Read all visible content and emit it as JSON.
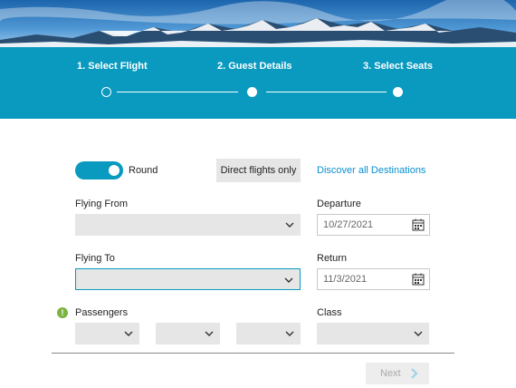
{
  "stepper": {
    "steps": [
      {
        "label": "1. Select Flight",
        "state": "current"
      },
      {
        "label": "2. Guest Details",
        "state": "upcoming"
      },
      {
        "label": "3. Select Seats",
        "state": "upcoming"
      }
    ]
  },
  "trip": {
    "toggle_label": "Round",
    "toggle_on": true,
    "direct_flights_label": "Direct flights only",
    "discover_link": "Discover all Destinations"
  },
  "form": {
    "flying_from_label": "Flying From",
    "flying_from_value": "",
    "flying_to_label": "Flying To",
    "flying_to_value": "",
    "departure_label": "Departure",
    "departure_value": "10/27/2021",
    "return_label": "Return",
    "return_value": "11/3/2021",
    "passengers_label": "Passengers",
    "class_label": "Class",
    "next_label": "Next"
  },
  "colors": {
    "accent": "#0a9ac0",
    "link": "#0a8fcf",
    "info": "#7cb342"
  },
  "icons": [
    "mountain-banner",
    "chevron-down-icon",
    "calendar-icon",
    "info-icon",
    "chevron-right-icon"
  ]
}
